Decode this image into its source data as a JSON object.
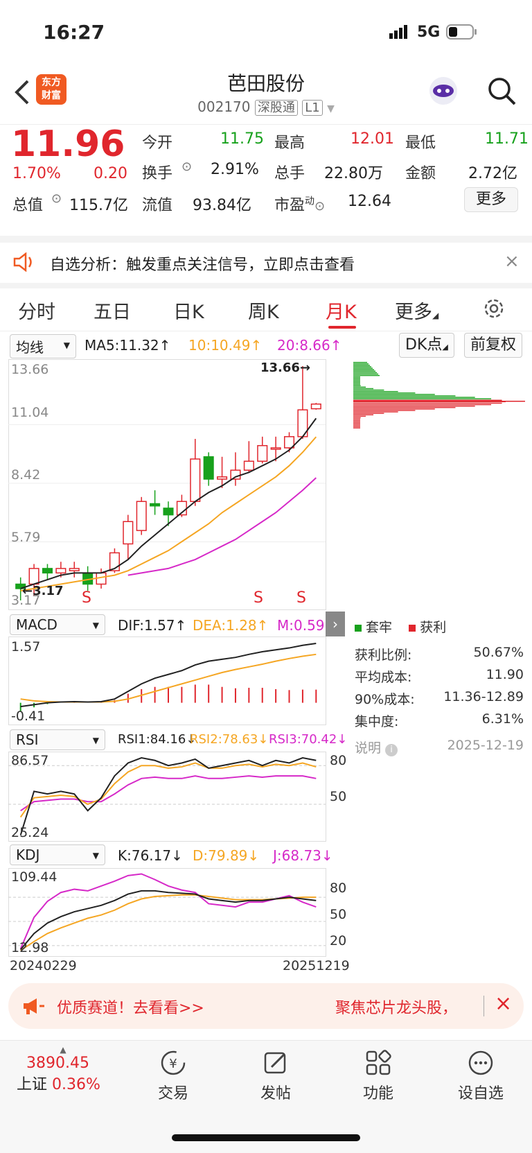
{
  "status": {
    "time": "16:27",
    "network": "5G"
  },
  "header": {
    "logo_line1": "东方",
    "logo_line2": "财富",
    "title": "芭田股份",
    "code": "002170",
    "badge": "深股通",
    "level": "L1"
  },
  "quote": {
    "price": "11.96",
    "pct": "1.70%",
    "chg": "0.20",
    "open_label": "今开",
    "open": "11.75",
    "high_label": "最高",
    "high": "12.01",
    "low_label": "最低",
    "low": "11.71",
    "turnover_label": "换手",
    "turnover": "2.91%",
    "volume_label": "总手",
    "volume": "22.80万",
    "amount_label": "金额",
    "amount": "2.72亿",
    "mktcap_label": "总值",
    "mktcap": "115.7亿",
    "float_label": "流值",
    "float": "93.84亿",
    "pe_label": "市盈",
    "pe_sup": "动",
    "pe": "12.64",
    "more": "更多"
  },
  "alert": {
    "text": "自选分析：触发重点关注信号，立即点击查看"
  },
  "tabs": [
    "分时",
    "五日",
    "日K",
    "周K",
    "月K",
    "更多"
  ],
  "main_legend": {
    "select": "均线",
    "ma5": "MA5:11.32↑",
    "ma10": "10:10.49↑",
    "ma20": "20:8.66↑",
    "dk": "DK点",
    "fq": "前复权"
  },
  "price_axis": {
    "p1": "13.66",
    "p2": "11.04",
    "p3": "8.42",
    "p4": "5.79",
    "p5": "3.17",
    "max_marker": "13.66→",
    "min_marker": "←3.17"
  },
  "signals": [
    "S",
    "S",
    "S"
  ],
  "macd": {
    "select": "MACD",
    "dif": "DIF:1.57↑",
    "dea": "DEA:1.28↑",
    "m": "M:0.59",
    "top": "1.57",
    "bottom": "-0.41"
  },
  "rsi": {
    "select": "RSI",
    "r1": "RSI1:84.16↓",
    "r2": "RSI2:78.63↓",
    "r3": "RSI3:70.42↓",
    "top": "86.57",
    "bottom": "25.24",
    "l80": "80",
    "l50": "50"
  },
  "kdj": {
    "select": "KDJ",
    "k": "K:76.17↓",
    "d": "D:79.89↓",
    "j": "J:68.73↓",
    "top": "109.44",
    "bottom": "12.98",
    "l80": "80",
    "l50": "50",
    "l20": "20"
  },
  "dates": {
    "start": "20240229",
    "end": "20251219"
  },
  "chips": {
    "legend_trap": "套牢",
    "legend_profit": "获利",
    "rows": [
      {
        "label": "获利比例:",
        "value": "50.67%"
      },
      {
        "label": "平均成本:",
        "value": "11.90"
      },
      {
        "label": "90%成本:",
        "value": "11.36-12.89"
      },
      {
        "label": "集中度:",
        "value": "6.31%"
      }
    ],
    "note_label": "说明",
    "note_date": "2025-12-19"
  },
  "banner": {
    "left": "优质赛道！去看看>>",
    "right": "聚焦芯片龙头股，"
  },
  "bottom": {
    "index_value": "3890.45",
    "index_name": "上证",
    "index_pct": "0.36%",
    "nav": [
      "交易",
      "发帖",
      "功能",
      "设自选"
    ]
  },
  "colors": {
    "up": "#e0262d",
    "down": "#17a11c",
    "ma10": "#f5a623",
    "ma20": "#d629c8"
  },
  "chart_data": {
    "type": "candlestick",
    "candles": [
      {
        "o": 3.9,
        "c": 3.7,
        "h": 4.2,
        "l": 3.17
      },
      {
        "o": 3.9,
        "c": 4.6,
        "h": 4.8,
        "l": 3.4
      },
      {
        "o": 4.6,
        "c": 4.4,
        "h": 4.8,
        "l": 4.1
      },
      {
        "o": 4.4,
        "c": 4.6,
        "h": 4.9,
        "l": 4.2
      },
      {
        "o": 4.5,
        "c": 4.6,
        "h": 4.9,
        "l": 4.2
      },
      {
        "o": 4.4,
        "c": 3.9,
        "h": 4.7,
        "l": 3.6
      },
      {
        "o": 3.9,
        "c": 4.4,
        "h": 4.6,
        "l": 3.7
      },
      {
        "o": 4.5,
        "c": 5.3,
        "h": 5.5,
        "l": 4.4
      },
      {
        "o": 5.7,
        "c": 6.7,
        "h": 7.0,
        "l": 5.0
      },
      {
        "o": 6.3,
        "c": 7.6,
        "h": 7.8,
        "l": 6.1
      },
      {
        "o": 7.5,
        "c": 7.4,
        "h": 8.1,
        "l": 7.0
      },
      {
        "o": 7.3,
        "c": 7.0,
        "h": 7.6,
        "l": 6.5
      },
      {
        "o": 7.0,
        "c": 7.6,
        "h": 7.9,
        "l": 6.9
      },
      {
        "o": 7.6,
        "c": 9.5,
        "h": 10.4,
        "l": 7.4
      },
      {
        "o": 9.6,
        "c": 8.6,
        "h": 9.8,
        "l": 8.3
      },
      {
        "o": 8.6,
        "c": 8.7,
        "h": 9.6,
        "l": 8.2
      },
      {
        "o": 8.6,
        "c": 9.0,
        "h": 9.8,
        "l": 8.3
      },
      {
        "o": 9.0,
        "c": 9.4,
        "h": 10.3,
        "l": 8.9
      },
      {
        "o": 9.4,
        "c": 10.1,
        "h": 10.5,
        "l": 9.3
      },
      {
        "o": 10.0,
        "c": 10.0,
        "h": 10.5,
        "l": 9.4
      },
      {
        "o": 10.0,
        "c": 10.5,
        "h": 10.7,
        "l": 9.8
      },
      {
        "o": 10.5,
        "c": 11.7,
        "h": 13.66,
        "l": 10.4
      },
      {
        "o": 11.75,
        "c": 11.96,
        "h": 12.01,
        "l": 11.71
      }
    ],
    "ma5": [
      3.7,
      3.9,
      4.1,
      4.3,
      4.4,
      4.4,
      4.4,
      4.6,
      5.0,
      5.6,
      6.1,
      6.6,
      7.1,
      7.6,
      8.0,
      8.3,
      8.7,
      8.9,
      9.2,
      9.5,
      9.9,
      10.5,
      11.32
    ],
    "ma10": [
      3.6,
      3.7,
      3.8,
      3.9,
      4.0,
      4.1,
      4.2,
      4.3,
      4.5,
      4.8,
      5.1,
      5.4,
      5.8,
      6.2,
      6.6,
      7.1,
      7.5,
      7.9,
      8.3,
      8.7,
      9.2,
      9.8,
      10.49
    ],
    "ma20": [
      null,
      null,
      null,
      null,
      null,
      null,
      null,
      null,
      4.3,
      4.4,
      4.5,
      4.6,
      4.8,
      5.0,
      5.3,
      5.6,
      5.9,
      6.3,
      6.7,
      7.1,
      7.6,
      8.1,
      8.66
    ],
    "ylim": [
      3.17,
      13.66
    ]
  }
}
